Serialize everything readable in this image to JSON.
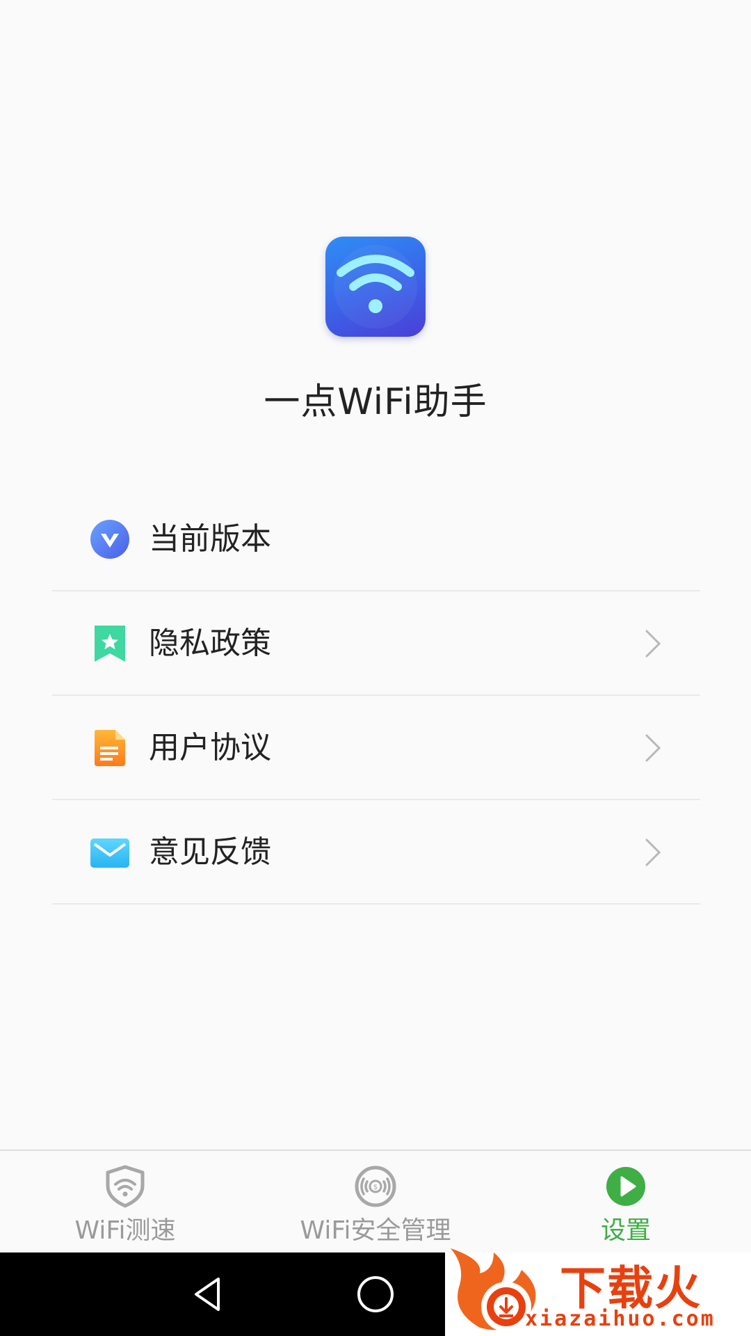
{
  "app": {
    "name": "一点WiFi助手"
  },
  "menu": {
    "items": [
      {
        "label": "当前版本",
        "icon": "version-v-icon",
        "has_chevron": false
      },
      {
        "label": "隐私政策",
        "icon": "bookmark-star-icon",
        "has_chevron": true
      },
      {
        "label": "用户协议",
        "icon": "document-icon",
        "has_chevron": true
      },
      {
        "label": "意见反馈",
        "icon": "mail-icon",
        "has_chevron": true
      }
    ]
  },
  "tabs": [
    {
      "label": "WiFi测速",
      "icon": "wifi-shield-icon",
      "active": false
    },
    {
      "label": "WiFi安全管理",
      "icon": "wifi-coin-icon",
      "active": false
    },
    {
      "label": "设置",
      "icon": "play-circle-icon",
      "active": true
    }
  ],
  "watermark": {
    "text": "下载火",
    "url": "xiazaihuo.com"
  },
  "colors": {
    "active_tab": "#3fae45",
    "inactive_tab": "#9a9a9a",
    "logo_blue": "#3a63e8",
    "watermark": "#e8400f"
  }
}
